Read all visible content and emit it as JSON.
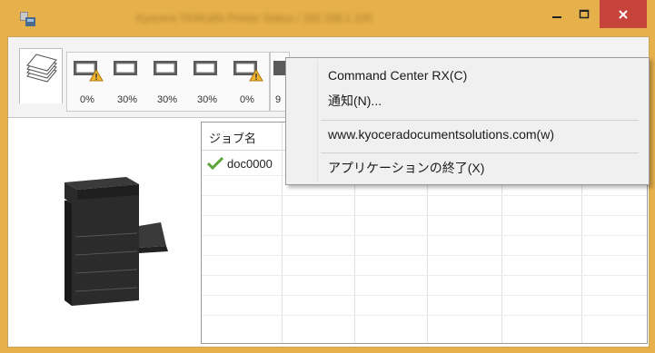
{
  "window": {
    "title_blurred": "Kyocera TASKalfa Printer Status / 192.168.1.100",
    "controls": {
      "minimize": "–",
      "maximize": "☐",
      "close": "✕"
    }
  },
  "icons": {
    "app": "printer-app-icon",
    "stack": "paper-stack-icon",
    "settings": "gear-icon",
    "check": "check-icon",
    "warning": "warning-icon"
  },
  "trays": [
    {
      "label": "0%",
      "warning": true
    },
    {
      "label": "30%",
      "warning": false
    },
    {
      "label": "30%",
      "warning": false
    },
    {
      "label": "30%",
      "warning": false
    },
    {
      "label": "0%",
      "warning": true
    },
    {
      "label": "9",
      "warning": false
    }
  ],
  "job_list": {
    "header": "ジョブ名",
    "rows": [
      {
        "name": "doc0000"
      }
    ]
  },
  "context_menu": {
    "items": [
      {
        "label": "Command Center RX(C)"
      },
      {
        "label": "通知(N)..."
      },
      {
        "label": "www.kyoceradocumentsolutions.com(w)"
      },
      {
        "label": "アプリケーションの終了(X)"
      }
    ]
  },
  "colors": {
    "titlebar": "#e6b04a",
    "close_button": "#c7443d",
    "check_green": "#5aa53a"
  }
}
